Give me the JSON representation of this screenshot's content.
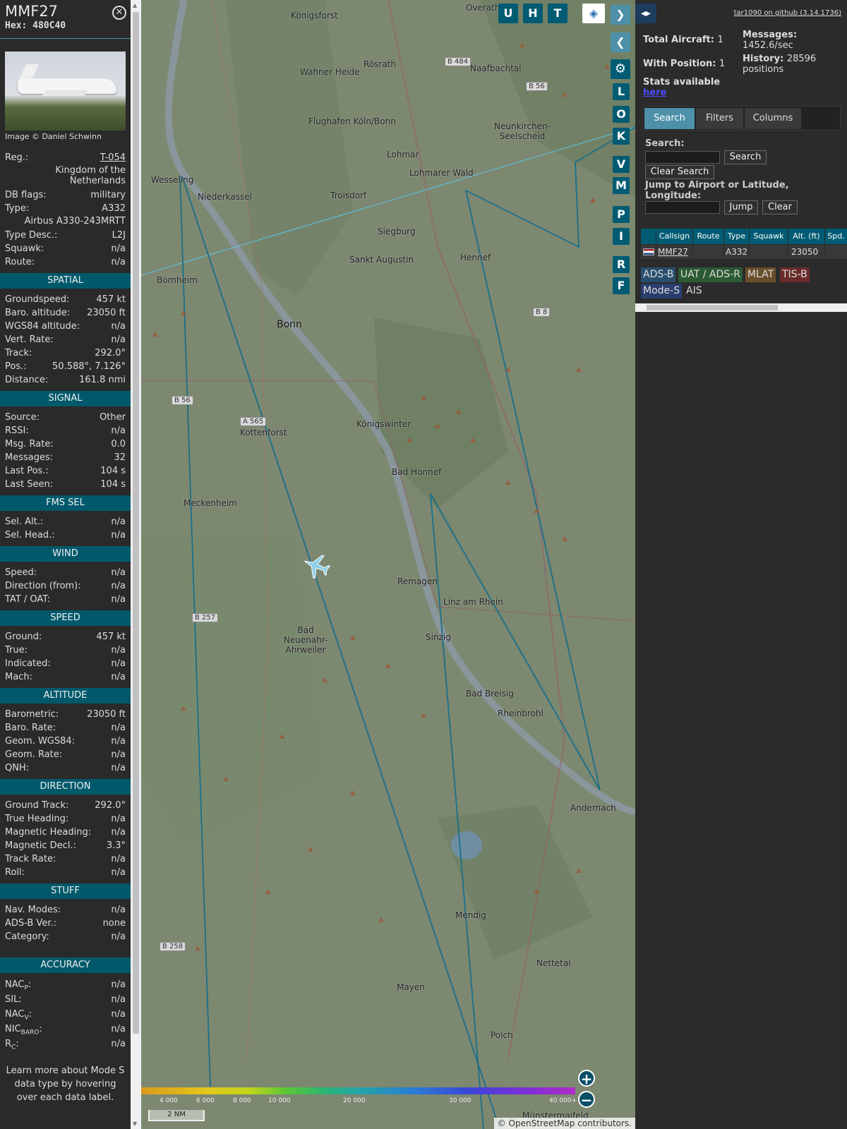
{
  "info": {
    "callsign": "MMF27",
    "hex_label": "Hex:",
    "hex": "480C40",
    "image_credit": "Image © Daniel Schwinn",
    "reg_label": "Reg.:",
    "reg": "T-054",
    "country": "Kingdom of the Netherlands",
    "dbflags_label": "DB flags:",
    "dbflags": "military",
    "type_label": "Type:",
    "type": "A332",
    "type_full": "Airbus A330-243MRTT",
    "typedesc_label": "Type Desc.:",
    "typedesc": "L2J",
    "squawk_label": "Squawk:",
    "squawk": "n/a",
    "route_label": "Route:",
    "route": "n/a",
    "sections": [
      {
        "title": "SPATIAL",
        "rows": [
          {
            "label": "Groundspeed:",
            "value": "457 kt"
          },
          {
            "label": "Baro. altitude:",
            "value": "23050 ft"
          },
          {
            "label": "WGS84 altitude:",
            "value": "n/a"
          },
          {
            "label": "Vert. Rate:",
            "value": "n/a"
          },
          {
            "label": "Track:",
            "value": "292.0°"
          },
          {
            "label": "Pos.:",
            "value": "50.588°, 7.126°"
          },
          {
            "label": "Distance:",
            "value": "161.8 nmi"
          }
        ]
      },
      {
        "title": "SIGNAL",
        "rows": [
          {
            "label": "Source:",
            "value": "Other"
          },
          {
            "label": "RSSI:",
            "value": "n/a"
          },
          {
            "label": "Msg. Rate:",
            "value": "0.0"
          },
          {
            "label": "Messages:",
            "value": "32"
          },
          {
            "label": "Last Pos.:",
            "value": "104 s"
          },
          {
            "label": "Last Seen:",
            "value": "104 s"
          }
        ]
      },
      {
        "title": "FMS SEL",
        "rows": [
          {
            "label": "Sel. Alt.:",
            "value": "n/a"
          },
          {
            "label": "Sel. Head.:",
            "value": "n/a"
          }
        ]
      },
      {
        "title": "WIND",
        "rows": [
          {
            "label": "Speed:",
            "value": "n/a"
          },
          {
            "label": "Direction (from):",
            "value": "n/a"
          },
          {
            "label": "TAT / OAT:",
            "value": "n/a"
          }
        ]
      },
      {
        "title": "SPEED",
        "rows": [
          {
            "label": "Ground:",
            "value": "457 kt"
          },
          {
            "label": "True:",
            "value": "n/a"
          },
          {
            "label": "Indicated:",
            "value": "n/a"
          },
          {
            "label": "Mach:",
            "value": "n/a"
          }
        ]
      },
      {
        "title": "ALTITUDE",
        "rows": [
          {
            "label": "Barometric:",
            "value": "23050 ft"
          },
          {
            "label": "Baro. Rate:",
            "value": "n/a"
          },
          {
            "label": "Geom. WGS84:",
            "value": "n/a"
          },
          {
            "label": "Geom. Rate:",
            "value": "n/a"
          },
          {
            "label": "QNH:",
            "value": "n/a"
          }
        ]
      },
      {
        "title": "DIRECTION",
        "rows": [
          {
            "label": "Ground Track:",
            "value": "292.0°"
          },
          {
            "label": "True Heading:",
            "value": "n/a"
          },
          {
            "label": "Magnetic Heading:",
            "value": "n/a"
          },
          {
            "label": "Magnetic Decl.:",
            "value": "3.3°"
          },
          {
            "label": "Track Rate:",
            "value": "n/a"
          },
          {
            "label": "Roll:",
            "value": "n/a"
          }
        ]
      },
      {
        "title": "STUFF",
        "rows": [
          {
            "label": "Nav. Modes:",
            "value": "n/a"
          },
          {
            "label": "ADS-B Ver.:",
            "value": "none"
          },
          {
            "label": "Category:",
            "value": "n/a"
          }
        ]
      }
    ],
    "accuracy_title": "ACCURACY",
    "accuracy": [
      {
        "label": "NAC",
        "sub": "P",
        "value": "n/a"
      },
      {
        "label": "SIL",
        "sub": "",
        "value": "n/a"
      },
      {
        "label": "NAC",
        "sub": "V",
        "value": "n/a"
      },
      {
        "label": "NIC",
        "sub": "BARO",
        "value": "n/a"
      },
      {
        "label": "R",
        "sub": "C",
        "value": "n/a"
      }
    ],
    "learn_more": "Learn more about Mode S data type by hovering over each data label."
  },
  "map": {
    "buttons_top": [
      "U",
      "H",
      "T"
    ],
    "buttons_side": [
      "L",
      "O",
      "K",
      "V",
      "M",
      "P",
      "I",
      "R",
      "F"
    ],
    "places": [
      {
        "name": "Overath"
      },
      {
        "name": "Königsforst"
      },
      {
        "name": "Rösrath"
      },
      {
        "name": "Wahner Heide"
      },
      {
        "name": "Flughafen Köln/Bonn"
      },
      {
        "name": "Lohmar"
      },
      {
        "name": "Lohmarer Wald"
      },
      {
        "name": "Neunkirchen-Seelscheid"
      },
      {
        "name": "Wesseling"
      },
      {
        "name": "Niederkassel"
      },
      {
        "name": "Troisdorf"
      },
      {
        "name": "Siegburg"
      },
      {
        "name": "Sankt Augustin"
      },
      {
        "name": "Hennef"
      },
      {
        "name": "Bornheim"
      },
      {
        "name": "Bonn"
      },
      {
        "name": "Königswinter"
      },
      {
        "name": "Kottenforst"
      },
      {
        "name": "Bad Honnef"
      },
      {
        "name": "Meckenheim"
      },
      {
        "name": "Remagen"
      },
      {
        "name": "Linz am Rhein"
      },
      {
        "name": "Bad Neuenahr-Ahrweiler"
      },
      {
        "name": "Sinzig"
      },
      {
        "name": "Bad Breisig"
      },
      {
        "name": "Rheinbrohl"
      },
      {
        "name": "Andernach"
      },
      {
        "name": "Mendig"
      },
      {
        "name": "Mayen"
      },
      {
        "name": "Polch"
      },
      {
        "name": "Münstermaifeld"
      },
      {
        "name": "Nettetal"
      },
      {
        "name": "Naafbachtal"
      }
    ],
    "roads": [
      "B 484",
      "B 56",
      "B 8",
      "B 56",
      "A 565",
      "B 257",
      "B 258"
    ],
    "altitude_labels": [
      "4 000",
      "6 000",
      "8 000",
      "10 000",
      "20 000",
      "30 000",
      "40 000+"
    ],
    "scale_label": "2 NM",
    "attribution": "© OpenStreetMap contributors.",
    "zoom_in": "+",
    "zoom_out": "−"
  },
  "right": {
    "github_link": "tar1090 on github (3.14.1736)",
    "total_aircraft_label": "Total Aircraft:",
    "total_aircraft": "1",
    "with_position_label": "With Position:",
    "with_position": "1",
    "messages_label": "Messages:",
    "messages_rate": "1452.6/sec",
    "history_label": "History:",
    "history_value": "28596",
    "history_unit": "positions",
    "stats_label": "Stats available",
    "stats_link": "here",
    "tabs": [
      "Search",
      "Filters",
      "Columns"
    ],
    "search_label": "Search:",
    "search_button": "Search",
    "clear_search_button": "Clear Search",
    "jump_label": "Jump to Airport or Latitude, Longitude:",
    "jump_button": "Jump",
    "clear_button": "Clear",
    "table_headers": [
      "",
      "Callsign",
      "Route",
      "Type",
      "Squawk",
      "Alt. (ft)",
      "Spd."
    ],
    "table_row": {
      "callsign": "MMF27",
      "route": "",
      "type": "A332",
      "squawk": "",
      "alt": "23050",
      "spd": ""
    },
    "badges": [
      {
        "label": "ADS-B",
        "color": "#2a4f6e"
      },
      {
        "label": "UAT / ADS-R",
        "color": "#2b5a33"
      },
      {
        "label": "MLAT",
        "color": "#6a4e2a"
      },
      {
        "label": "TIS-B",
        "color": "#6a2a2a"
      },
      {
        "label": "Mode-S",
        "color": "#2a3f6e"
      },
      {
        "label": "AIS",
        "color": "#2b2b2b"
      }
    ]
  }
}
